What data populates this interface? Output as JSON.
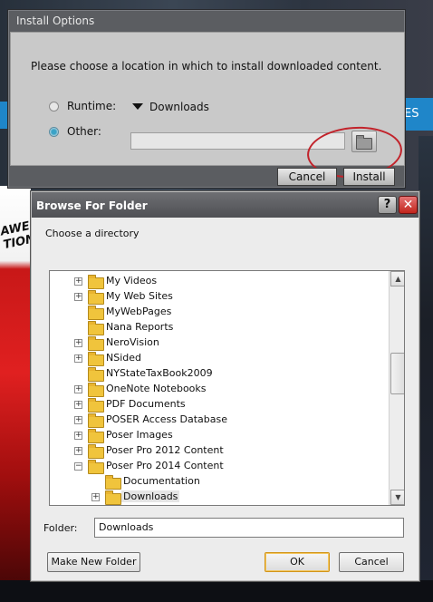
{
  "background": {
    "right_strip_text": "ES",
    "left_strip_text": "AWES\nTION"
  },
  "install_dialog": {
    "title": "Install Options",
    "message": "Please choose a location in which to install downloaded content.",
    "runtime_label": "Runtime:",
    "runtime_value": "Downloads",
    "other_label": "Other:",
    "other_path": "",
    "selected_option": "Other",
    "cancel_label": "Cancel",
    "install_label": "Install"
  },
  "browse_dialog": {
    "title": "Browse For Folder",
    "help_glyph": "?",
    "close_glyph": "✕",
    "prompt": "Choose a directory",
    "tree_items": [
      {
        "label": "My Videos",
        "expandable": true,
        "indent": 0,
        "icon": "videos-folder-icon"
      },
      {
        "label": "My Web Sites",
        "expandable": true,
        "indent": 0,
        "icon": "web-folder-icon"
      },
      {
        "label": "MyWebPages",
        "expandable": false,
        "indent": 0,
        "icon": "folder-icon"
      },
      {
        "label": "Nana Reports",
        "expandable": false,
        "indent": 0,
        "icon": "folder-icon"
      },
      {
        "label": "NeroVision",
        "expandable": true,
        "indent": 0,
        "icon": "folder-icon"
      },
      {
        "label": "NSided",
        "expandable": true,
        "indent": 0,
        "icon": "folder-icon"
      },
      {
        "label": "NYStateTaxBook2009",
        "expandable": false,
        "indent": 0,
        "icon": "folder-icon"
      },
      {
        "label": "OneNote Notebooks",
        "expandable": true,
        "indent": 0,
        "icon": "folder-icon"
      },
      {
        "label": "PDF Documents",
        "expandable": true,
        "indent": 0,
        "icon": "folder-icon"
      },
      {
        "label": "POSER Access Database",
        "expandable": true,
        "indent": 0,
        "icon": "folder-icon"
      },
      {
        "label": "Poser Images",
        "expandable": true,
        "indent": 0,
        "icon": "folder-icon"
      },
      {
        "label": "Poser Pro 2012 Content",
        "expandable": true,
        "indent": 0,
        "icon": "folder-icon"
      },
      {
        "label": "Poser Pro 2014 Content",
        "expandable": true,
        "expanded": true,
        "indent": 0,
        "icon": "folder-icon"
      },
      {
        "label": "Documentation",
        "expandable": false,
        "indent": 1,
        "icon": "folder-icon"
      },
      {
        "label": "Downloads",
        "expandable": true,
        "indent": 1,
        "icon": "folder-icon",
        "selected": true
      }
    ],
    "folder_label": "Folder:",
    "folder_value": "Downloads",
    "make_new_folder_label": "Make New Folder",
    "ok_label": "OK",
    "cancel_label": "Cancel"
  },
  "colors": {
    "highlight_ellipse": "#c2232b",
    "close_button": "#c2251c",
    "default_button_border": "#d29418"
  }
}
